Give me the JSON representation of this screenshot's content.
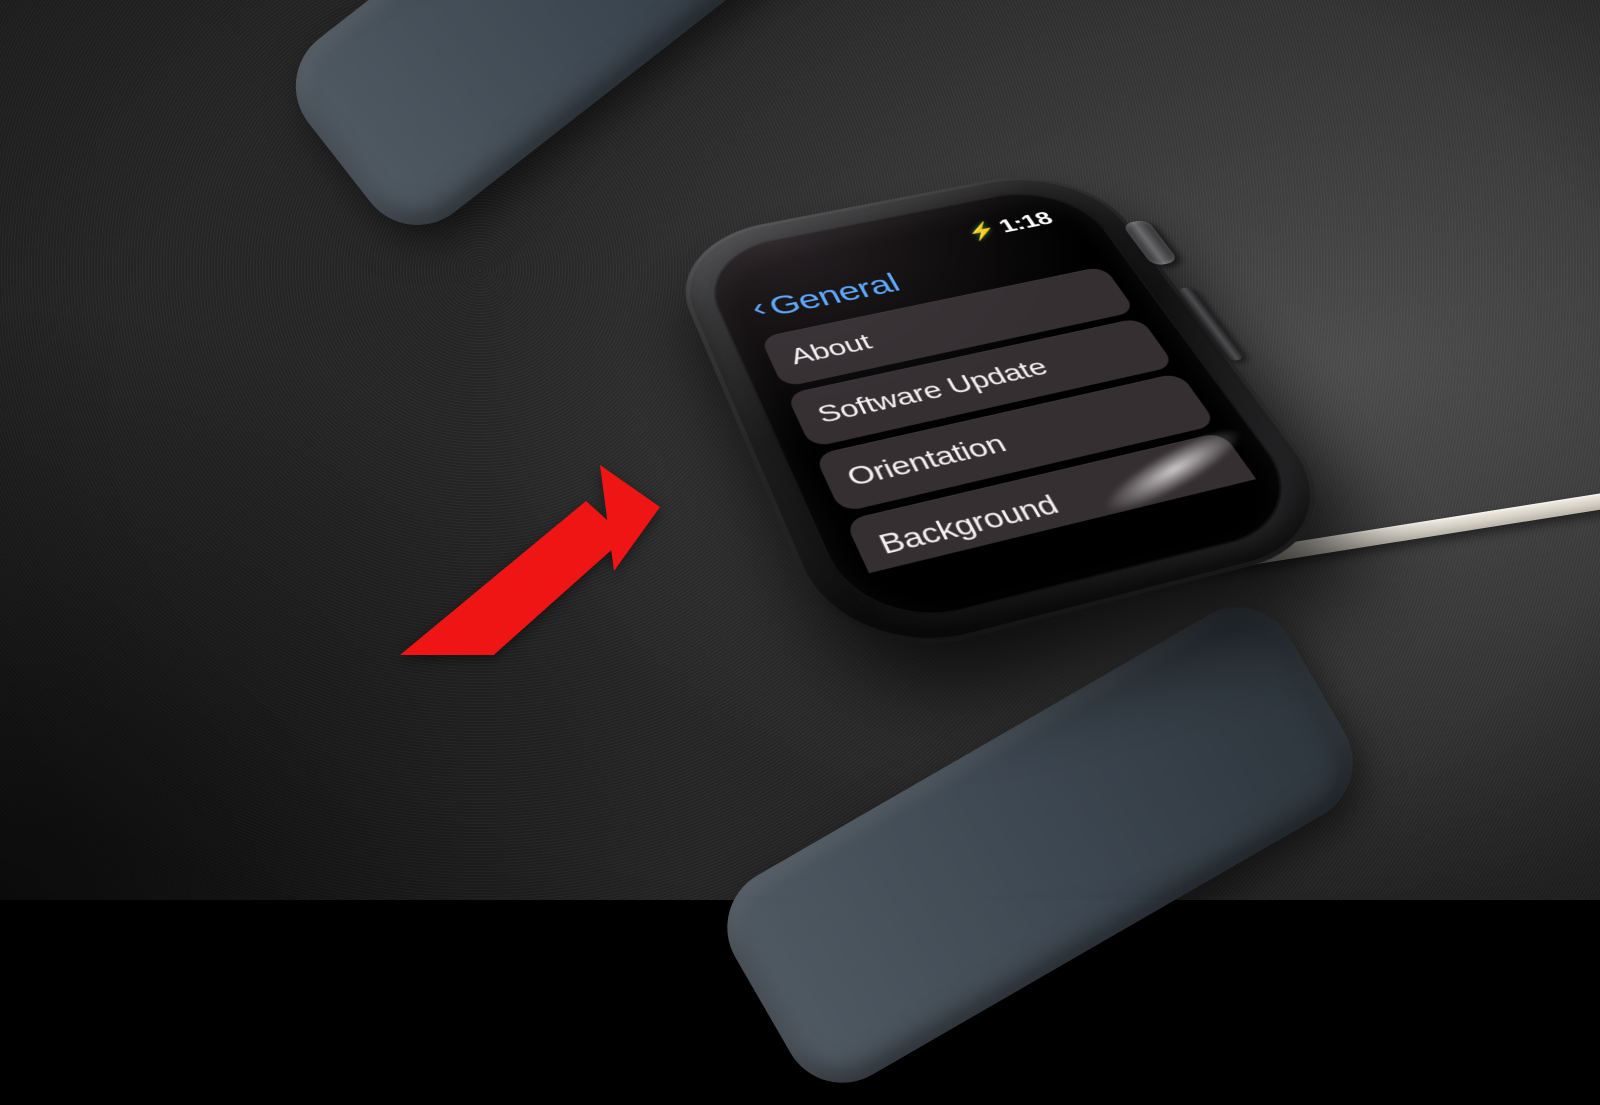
{
  "status": {
    "charging_icon": "bolt-icon",
    "time": "1:18"
  },
  "header": {
    "back_icon": "chevron-left-icon",
    "title": "General"
  },
  "menu": {
    "items": [
      {
        "label": "About"
      },
      {
        "label": "Software Update"
      },
      {
        "label": "Orientation"
      },
      {
        "label": "Background"
      }
    ]
  },
  "annotation": {
    "arrow_color": "#f01515",
    "target_item_index": 1
  }
}
